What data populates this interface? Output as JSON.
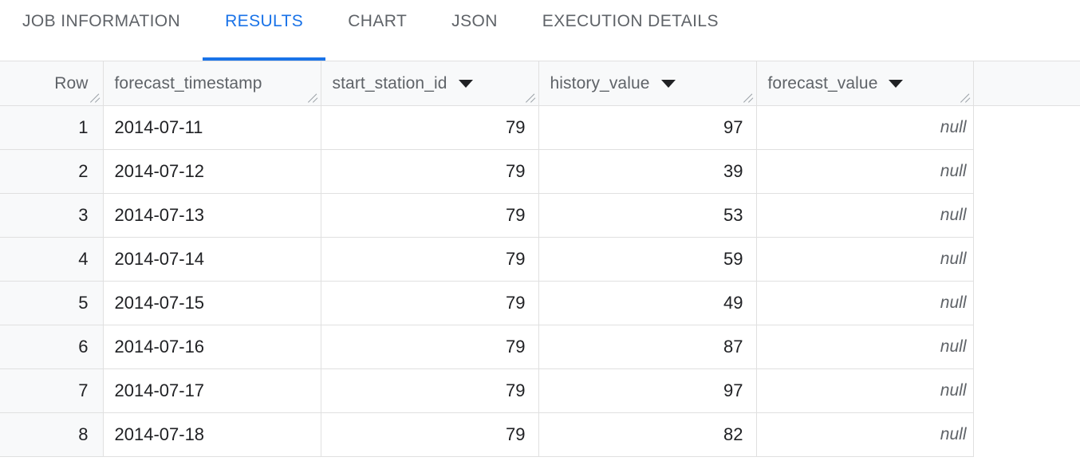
{
  "tabs": [
    {
      "label": "JOB INFORMATION",
      "active": false,
      "name": "tab-job-information"
    },
    {
      "label": "RESULTS",
      "active": true,
      "name": "tab-results"
    },
    {
      "label": "CHART",
      "active": false,
      "name": "tab-chart"
    },
    {
      "label": "JSON",
      "active": false,
      "name": "tab-json"
    },
    {
      "label": "EXECUTION DETAILS",
      "active": false,
      "name": "tab-execution-details"
    }
  ],
  "colors": {
    "accent": "#1a73e8",
    "header_text": "#5f6368",
    "body_text": "#202124",
    "header_bg": "#f8f9fa",
    "border": "#e0e0e0",
    "null_text": "#5f6368"
  },
  "table": {
    "columns": [
      {
        "label": "Row",
        "sortable": false,
        "align": "right"
      },
      {
        "label": "forecast_timestamp",
        "sortable": false,
        "align": "left"
      },
      {
        "label": "start_station_id",
        "sortable": true,
        "align": "right"
      },
      {
        "label": "history_value",
        "sortable": true,
        "align": "right"
      },
      {
        "label": "forecast_value",
        "sortable": true,
        "align": "right"
      }
    ],
    "rows": [
      {
        "row": "1",
        "forecast_timestamp": "2014-07-11",
        "start_station_id": "79",
        "history_value": "97",
        "forecast_value": "null"
      },
      {
        "row": "2",
        "forecast_timestamp": "2014-07-12",
        "start_station_id": "79",
        "history_value": "39",
        "forecast_value": "null"
      },
      {
        "row": "3",
        "forecast_timestamp": "2014-07-13",
        "start_station_id": "79",
        "history_value": "53",
        "forecast_value": "null"
      },
      {
        "row": "4",
        "forecast_timestamp": "2014-07-14",
        "start_station_id": "79",
        "history_value": "59",
        "forecast_value": "null"
      },
      {
        "row": "5",
        "forecast_timestamp": "2014-07-15",
        "start_station_id": "79",
        "history_value": "49",
        "forecast_value": "null"
      },
      {
        "row": "6",
        "forecast_timestamp": "2014-07-16",
        "start_station_id": "79",
        "history_value": "87",
        "forecast_value": "null"
      },
      {
        "row": "7",
        "forecast_timestamp": "2014-07-17",
        "start_station_id": "79",
        "history_value": "97",
        "forecast_value": "null"
      },
      {
        "row": "8",
        "forecast_timestamp": "2014-07-18",
        "start_station_id": "79",
        "history_value": "82",
        "forecast_value": "null"
      }
    ]
  },
  "icons": {
    "sort_caret": "chevron-down-icon",
    "resize_grip": "resize-grip-icon"
  }
}
